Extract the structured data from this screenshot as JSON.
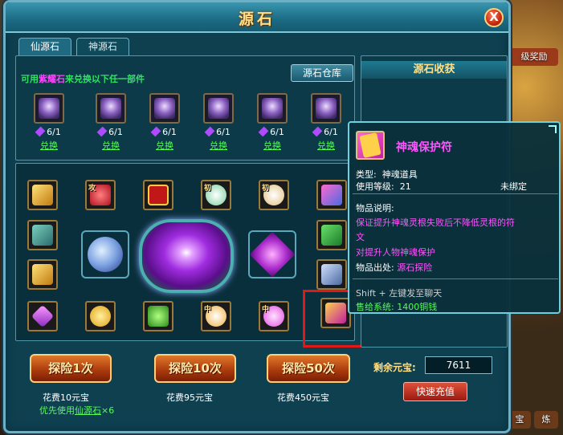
{
  "window": {
    "title": "源石",
    "close_label": "X"
  },
  "tabs": [
    {
      "label": "仙源石"
    },
    {
      "label": "神源石"
    }
  ],
  "notice": {
    "part1": "可用",
    "part2": "紫耀石",
    "part3": "来兑换以下任一部件"
  },
  "storage_button": "源石仓库",
  "exchange_items": [
    {
      "count": "6/1",
      "link": "兑换",
      "icon": "armor-piece-icon"
    },
    {
      "count": "6/1",
      "link": "兑换",
      "icon": "armor-piece-icon"
    },
    {
      "count": "6/1",
      "link": "兑换",
      "icon": "armor-piece-icon"
    },
    {
      "count": "6/1",
      "link": "兑换",
      "icon": "armor-piece-icon"
    },
    {
      "count": "6/1",
      "link": "兑换",
      "icon": "armor-piece-icon"
    },
    {
      "count": "6/1",
      "link": "兑换",
      "icon": "armor-piece-icon"
    }
  ],
  "grid_items": {
    "badges": [
      "攻",
      "初",
      "初",
      "中",
      "中"
    ]
  },
  "explore_buttons": [
    "探险1次",
    "探险10次",
    "探险50次"
  ],
  "costs": [
    "花费10元宝",
    "花费95元宝",
    "花费450元宝"
  ],
  "priority": {
    "text": "优先使用",
    "link": "仙源石",
    "suffix": "×6"
  },
  "right_panel": {
    "title": "源石收获"
  },
  "remaining": {
    "label": "剩余元宝:",
    "value": "7611"
  },
  "recharge_button": "快速充值",
  "tooltip": {
    "name": "神魂保护符",
    "type_label": "类型:",
    "type_value": "神魂道具",
    "level_label": "使用等级:",
    "level_value": "21",
    "bind_status": "未绑定",
    "desc_label": "物品说明:",
    "desc_line1": "保证提升神魂灵根失败后不降低灵根的符",
    "desc_line2": "文",
    "desc_line3": "对提升人物神魂保护",
    "source_label": "物品出处:",
    "source_value": "源石探险",
    "hint": "Shift + 左键发至聊天",
    "sell_label": "售给系统:",
    "sell_value": "1400铜钱"
  },
  "bg_chips": [
    "级奖励",
    "宝",
    "炼"
  ],
  "colors": {
    "accent": "#ffe089",
    "panel": "#0c3a48",
    "highlight": "#e01818",
    "magenta": "#ff55ff",
    "green": "#55ff55"
  }
}
